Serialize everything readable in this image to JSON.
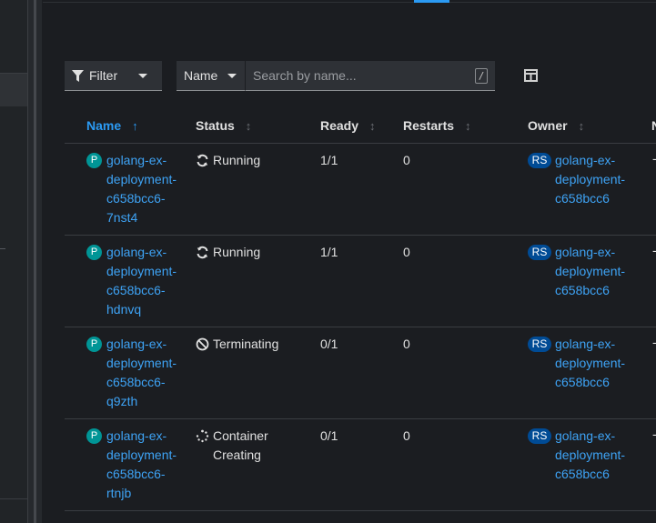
{
  "toolbar": {
    "filter_label": "Filter",
    "name_select_value": "Name",
    "search_placeholder": "Search by name...",
    "search_shortcut": "/"
  },
  "columns": {
    "name": "Name",
    "status": "Status",
    "ready": "Ready",
    "restarts": "Restarts",
    "owner": "Owner",
    "next": "N"
  },
  "rows": [
    {
      "pod_badge": "P",
      "name_lines": [
        "golang-ex-",
        "deployment-",
        "c658bcc6-",
        "7nst4"
      ],
      "status_icon": "sync-icon",
      "status_lines": [
        "Running"
      ],
      "ready": "1/1",
      "restarts": "0",
      "owner_badge": "RS",
      "owner_lines": [
        "golang-ex-",
        "deployment-",
        "c658bcc6"
      ],
      "next": "-"
    },
    {
      "pod_badge": "P",
      "name_lines": [
        "golang-ex-",
        "deployment-",
        "c658bcc6-",
        "hdnvq"
      ],
      "status_icon": "sync-icon",
      "status_lines": [
        "Running"
      ],
      "ready": "1/1",
      "restarts": "0",
      "owner_badge": "RS",
      "owner_lines": [
        "golang-ex-",
        "deployment-",
        "c658bcc6"
      ],
      "next": "-"
    },
    {
      "pod_badge": "P",
      "name_lines": [
        "golang-ex-",
        "deployment-",
        "c658bcc6-",
        "q9zth"
      ],
      "status_icon": "ban-icon",
      "status_lines": [
        "Terminating"
      ],
      "ready": "0/1",
      "restarts": "0",
      "owner_badge": "RS",
      "owner_lines": [
        "golang-ex-",
        "deployment-",
        "c658bcc6"
      ],
      "next": "-"
    },
    {
      "pod_badge": "P",
      "name_lines": [
        "golang-ex-",
        "deployment-",
        "c658bcc6-",
        "rtnjb"
      ],
      "status_icon": "spinner-icon",
      "status_lines": [
        "Container",
        "Creating"
      ],
      "ready": "0/1",
      "restarts": "0",
      "owner_badge": "RS",
      "owner_lines": [
        "golang-ex-",
        "deployment-",
        "c658bcc6"
      ],
      "next": "-"
    }
  ],
  "colors": {
    "link": "#3ea3f5",
    "accent": "#2b9af3",
    "pod_badge": "#009596",
    "rs_badge": "#004b95"
  }
}
